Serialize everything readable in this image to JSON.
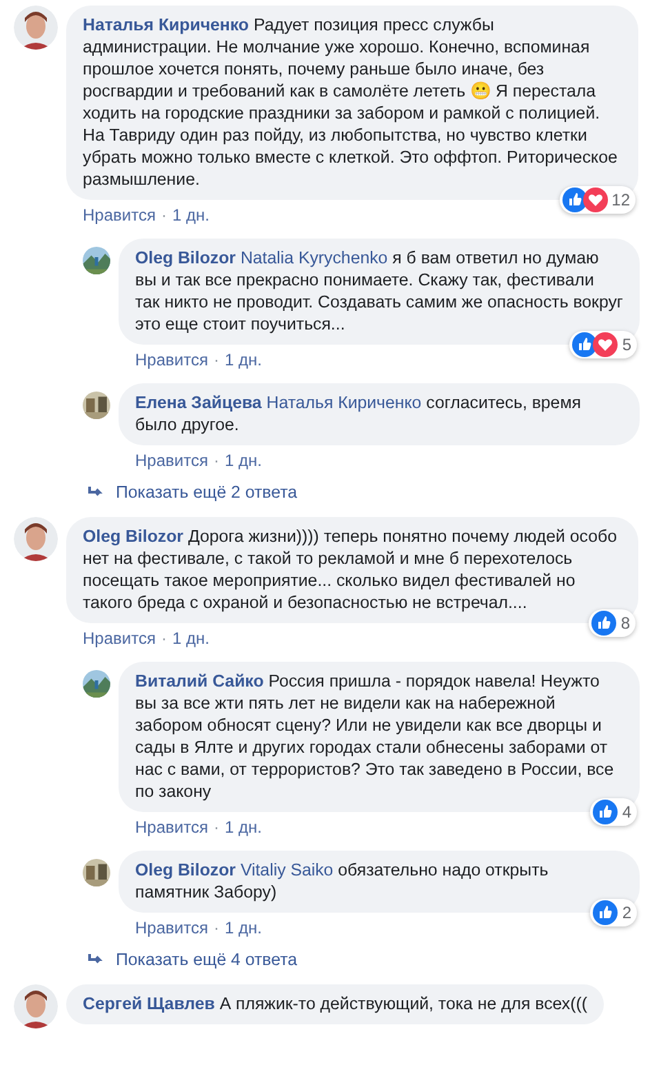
{
  "entries": [
    {
      "kind": "comment",
      "author": "Наталья Кириченко",
      "text": "Радует позиция пресс службы администрации. Не молчание уже хорошо. Конечно, вспоминая прошлое хочется понять, почему раньше было иначе, без росгвардии и требований как в самолёте лететь 😬 Я перестала ходить на городские праздники за забором и рамкой с полицией. На Тавриду один раз пойду, из любопытства, но чувство клетки убрать можно только вместе с клеткой. Это оффтоп. Риторическое размышление.",
      "like": "Нравится",
      "separator": "·",
      "time": "1 дн.",
      "reactions": [
        {
          "kind": "like"
        },
        {
          "kind": "love"
        }
      ],
      "reaction_count": "12"
    },
    {
      "kind": "reply",
      "author": "Oleg Bilozor",
      "mention": "Natalia Kyrychenko",
      "text": "я б вам ответил но думаю вы и так все прекрасно понимаете. Скажу так, фестивали так никто не проводит. Создавать самим же опасность вокруг это еще стоит поучиться...",
      "like": "Нравится",
      "separator": "·",
      "time": "1 дн.",
      "reactions": [
        {
          "kind": "like"
        },
        {
          "kind": "love"
        }
      ],
      "reaction_count": "5"
    },
    {
      "kind": "reply",
      "author": "Елена Зайцева",
      "mention": "Наталья Кириченко",
      "text": "согласитесь, время было другое.",
      "like": "Нравится",
      "separator": "·",
      "time": "1 дн."
    },
    {
      "kind": "more",
      "label": "Показать ещё 2 ответа"
    },
    {
      "kind": "comment",
      "author": "Oleg Bilozor",
      "text": "Дорога жизни)))) теперь понятно почему людей особо нет на фестивале, с такой то рекламой и мне б перехотелось посещать такое мероприятие... сколько видел фестивалей но такого бреда с охраной и безопасностью не встречал....",
      "like": "Нравится",
      "separator": "·",
      "time": "1 дн.",
      "reactions": [
        {
          "kind": "like"
        }
      ],
      "reaction_count": "8"
    },
    {
      "kind": "reply",
      "author": "Виталий Сайко",
      "text": "Россия пришла - порядок навела! Неужто вы за все жти пять лет не видели как на набережной забором обносят сцену? Или не увидели как все дворцы и сады в Ялте и других городах стали обнесены заборами от нас с вами, от террористов? Это так заведено в России, все по закону",
      "like": "Нравится",
      "separator": "·",
      "time": "1 дн.",
      "reactions": [
        {
          "kind": "like"
        }
      ],
      "reaction_count": "4"
    },
    {
      "kind": "reply",
      "author": "Oleg Bilozor",
      "mention": "Vitaliy Saiko",
      "text": "обязательно надо открыть памятник Забору)",
      "like": "Нравится",
      "separator": "·",
      "time": "1 дн.",
      "reactions": [
        {
          "kind": "like"
        }
      ],
      "reaction_count": "2"
    },
    {
      "kind": "more",
      "label": "Показать ещё 4 ответа"
    },
    {
      "kind": "comment",
      "author": "Сергей Щавлев",
      "text": "А пляжик-то действующий, тока не для всех((("
    }
  ]
}
